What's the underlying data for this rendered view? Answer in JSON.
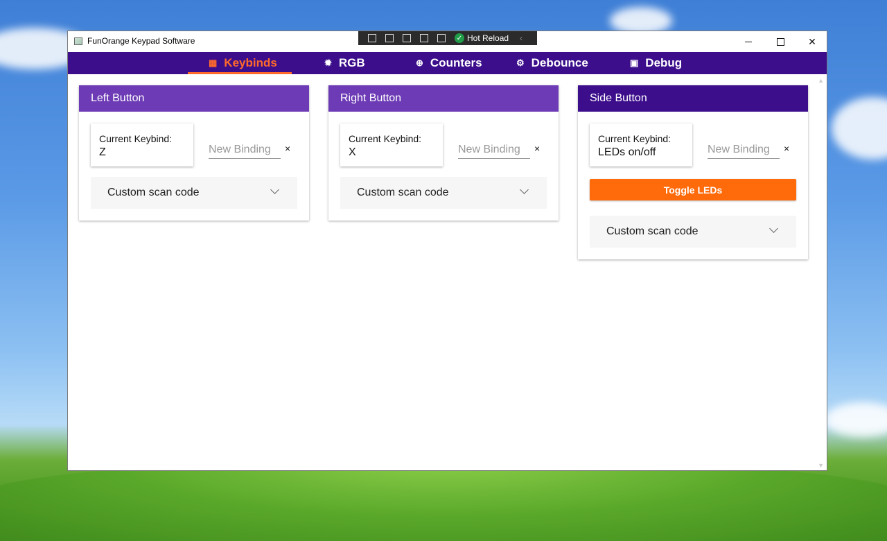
{
  "window": {
    "title": "FunOrange Keypad Software",
    "hot_reload_label": "Hot Reload"
  },
  "tabs": [
    {
      "label": "Keybinds",
      "icon": "keyboard-icon",
      "glyph": "▦",
      "active": true
    },
    {
      "label": "RGB",
      "icon": "bulb-icon",
      "glyph": "✹",
      "active": false
    },
    {
      "label": "Counters",
      "icon": "counter-icon",
      "glyph": "⊕",
      "active": false
    },
    {
      "label": "Debounce",
      "icon": "gear-icon",
      "glyph": "⚙",
      "active": false
    },
    {
      "label": "Debug",
      "icon": "debug-icon",
      "glyph": "▣",
      "active": false
    }
  ],
  "cards": [
    {
      "title": "Left Button",
      "header_color": "#6c3bb5",
      "current_label": "Current Keybind:",
      "current_value": "Z",
      "new_binding_placeholder": "New Binding",
      "clear_glyph": "×",
      "scan_code_label": "Custom scan code"
    },
    {
      "title": "Right Button",
      "header_color": "#6c3bb5",
      "current_label": "Current Keybind:",
      "current_value": "X",
      "new_binding_placeholder": "New Binding",
      "clear_glyph": "×",
      "scan_code_label": "Custom scan code"
    },
    {
      "title": "Side Button",
      "header_color": "#3c0e8c",
      "current_label": "Current Keybind:",
      "current_value": "LEDs on/off",
      "new_binding_placeholder": "New Binding",
      "clear_glyph": "×",
      "toggle_label": "Toggle LEDs",
      "scan_code_label": "Custom scan code"
    }
  ],
  "colors": {
    "nav_bg": "#3c0e8c",
    "accent": "#ff6a2a",
    "toggle_button": "#ff6a0a"
  }
}
